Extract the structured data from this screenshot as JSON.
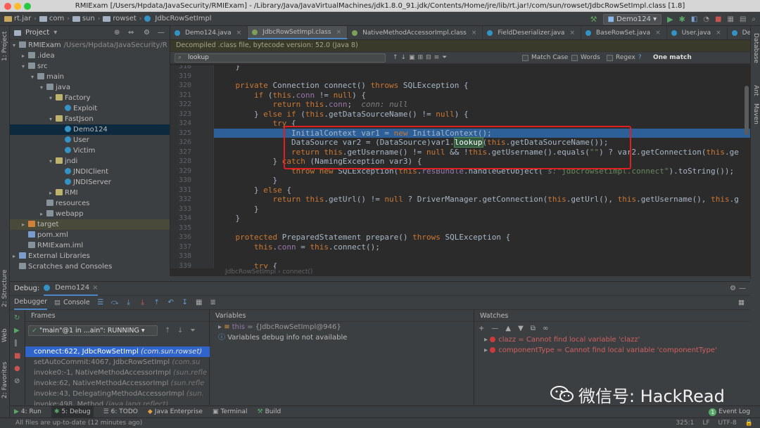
{
  "window": {
    "title": "RMIExam [/Users/Hpdata/JavaSecurity/RMIExam] - /Library/Java/JavaVirtualMachines/jdk1.8.0_91.jdk/Contents/Home/jre/lib/rt.jar!/com/sun/rowset/JdbcRowSetImpl.class [1.8]"
  },
  "navbar": {
    "crumbs": [
      "rt.jar",
      "com",
      "sun",
      "rowset",
      "JdbcRowSetImpl"
    ],
    "run_config": "Demo124"
  },
  "sidebar_left": {
    "labels": [
      "1: Project",
      "2: Structure",
      "Web",
      "2: Favorites"
    ]
  },
  "sidebar_right": {
    "labels": [
      "Database",
      "Ant",
      "Maven"
    ]
  },
  "project": {
    "header": "Project",
    "nodes": [
      {
        "label": "RMIExam",
        "path": "/Users/Hpdata/JavaSecurity/R",
        "indent": 0,
        "arrow": "▾",
        "icon": "folder"
      },
      {
        "label": ".idea",
        "indent": 1,
        "arrow": "▸",
        "icon": "folder"
      },
      {
        "label": "src",
        "indent": 1,
        "arrow": "▾",
        "icon": "folder"
      },
      {
        "label": "main",
        "indent": 2,
        "arrow": "▾",
        "icon": "folder"
      },
      {
        "label": "java",
        "indent": 3,
        "arrow": "▾",
        "icon": "folder"
      },
      {
        "label": "Factory",
        "indent": 4,
        "arrow": "▾",
        "icon": "package"
      },
      {
        "label": "Exploit",
        "indent": 5,
        "arrow": "",
        "icon": "class"
      },
      {
        "label": "FastJson",
        "indent": 4,
        "arrow": "▾",
        "icon": "package"
      },
      {
        "label": "Demo124",
        "indent": 5,
        "arrow": "",
        "icon": "class",
        "selected": true
      },
      {
        "label": "User",
        "indent": 5,
        "arrow": "",
        "icon": "class"
      },
      {
        "label": "Victim",
        "indent": 5,
        "arrow": "",
        "icon": "class"
      },
      {
        "label": "jndi",
        "indent": 4,
        "arrow": "▾",
        "icon": "package"
      },
      {
        "label": "JNDIClient",
        "indent": 5,
        "arrow": "",
        "icon": "class"
      },
      {
        "label": "JNDIServer",
        "indent": 5,
        "arrow": "",
        "icon": "class"
      },
      {
        "label": "RMI",
        "indent": 4,
        "arrow": "▸",
        "icon": "package"
      },
      {
        "label": "resources",
        "indent": 3,
        "arrow": "",
        "icon": "folder"
      },
      {
        "label": "webapp",
        "indent": 3,
        "arrow": "▸",
        "icon": "folder"
      },
      {
        "label": "target",
        "indent": 1,
        "arrow": "▸",
        "icon": "folder-orange",
        "selected_dim": true
      },
      {
        "label": "pom.xml",
        "indent": 1,
        "arrow": "",
        "icon": "maven"
      },
      {
        "label": "RMIExam.iml",
        "indent": 1,
        "arrow": "",
        "icon": "file"
      },
      {
        "label": "External Libraries",
        "indent": 0,
        "arrow": "▸",
        "icon": "library"
      },
      {
        "label": "Scratches and Consoles",
        "indent": 0,
        "arrow": "",
        "icon": "file"
      }
    ]
  },
  "editor": {
    "tabs": [
      {
        "label": "Demo124.java"
      },
      {
        "label": "JdbcRowSetImpl.class",
        "active": true
      },
      {
        "label": "NativeMethodAccessorImpl.class"
      },
      {
        "label": "FieldDeserializer.java"
      },
      {
        "label": "BaseRowSet.java"
      },
      {
        "label": "User.java"
      },
      {
        "label": "DefaultJSONParser"
      }
    ],
    "decompiled_notice": "Decompiled .class file, bytecode version: 52.0 (Java 8)",
    "find": {
      "query": "lookup",
      "match_case": "Match Case",
      "words": "Words",
      "regex": "Regex",
      "help": "?",
      "result": "One match"
    },
    "breadcrumb": "JdbcRowSetImpl  ›  connect()",
    "highlighted_line": 325,
    "lines": [
      {
        "n": "318",
        "html": "    }"
      },
      {
        "n": "319",
        "html": ""
      },
      {
        "n": "320",
        "html": "    <span class=\"kw\">private</span> Connection connect() <span class=\"kw\">throws</span> SQLException {"
      },
      {
        "n": "321",
        "html": "        <span class=\"kw\">if</span> (<span class=\"kw\">this</span>.<span class=\"fld\">conn</span> != <span class=\"kw\">null</span>) {"
      },
      {
        "n": "322",
        "html": "            <span class=\"kw\">return this</span>.<span class=\"fld\">conn</span>;  <span class=\"cmt\">conn: null</span>"
      },
      {
        "n": "323",
        "html": "        } <span class=\"kw\">else if</span> (<span class=\"kw\">this</span>.getDataSourceName() != <span class=\"kw\">null</span>) {"
      },
      {
        "n": "324",
        "html": "            <span class=\"kw\">try</span> {"
      },
      {
        "n": "325",
        "html": "                InitialContext var1 = <span class=\"kw\">new</span> InitialContext();"
      },
      {
        "n": "326",
        "html": "                DataSource var2 = (DataSource)var1.<span class=\"find\">lookup</span>(<span class=\"kw\">this</span>.getDataSourceName());"
      },
      {
        "n": "327",
        "html": "                <span class=\"kw\">return this</span>.getUsername() != <span class=\"kw\">null</span> &amp;&amp; !<span class=\"kw\">this</span>.getUsername().equals(<span class=\"str\">\"\"</span>) ? var2.getConnection(<span class=\"kw\">this</span>.ge"
      },
      {
        "n": "328",
        "html": "            } <span class=\"kw\">catch</span> (NamingException var3) {"
      },
      {
        "n": "329",
        "html": "                <span class=\"kw\">throw new</span> SQLException(<span class=\"kw\">this</span>.<span class=\"fld\">resBundle</span>.handleGetObject( <span class=\"cmt\">s:</span><span class=\"str\">\"jdbcrowsetimpl.connect\"</span>).toString());"
      },
      {
        "n": "330",
        "html": "            }"
      },
      {
        "n": "331",
        "html": "        } <span class=\"kw\">else</span> {"
      },
      {
        "n": "332",
        "html": "            <span class=\"kw\">return this</span>.getUrl() != <span class=\"kw\">null</span> ? DriverManager.getConnection(<span class=\"kw\">this</span>.getUrl(), <span class=\"kw\">this</span>.getUsername(), <span class=\"kw\">this</span>.g"
      },
      {
        "n": "333",
        "html": "        }"
      },
      {
        "n": "334",
        "html": "    }"
      },
      {
        "n": "335",
        "html": ""
      },
      {
        "n": "336",
        "html": "    <span class=\"kw\">protected</span> PreparedStatement prepare() <span class=\"kw\">throws</span> SQLException {"
      },
      {
        "n": "337",
        "html": "        <span class=\"kw\">this</span>.<span class=\"fld\">conn</span> = <span class=\"kw\">this</span>.connect();"
      },
      {
        "n": "338",
        "html": ""
      },
      {
        "n": "339",
        "html": "        <span class=\"kw\">try</span> {"
      }
    ]
  },
  "debug": {
    "title": "Debug:",
    "config": "Demo124",
    "tabs": [
      "Debugger",
      "Console"
    ],
    "frames_header": "Frames",
    "thread": "\"main\"@1 in ...ain\": RUNNING",
    "frames": [
      {
        "method": "connect:622, JdbcRowSetImpl",
        "pkg": "(com.sun.rowset)",
        "selected": true
      },
      {
        "method": "setAutoCommit:4067, JdbcRowSetImpl",
        "pkg": "(com.su"
      },
      {
        "method": "invoke0:-1, NativeMethodAccessorImpl",
        "pkg": "(sun.refle"
      },
      {
        "method": "invoke:62, NativeMethodAccessorImpl",
        "pkg": "(sun.refle"
      },
      {
        "method": "invoke:43, DelegatingMethodAccessorImpl",
        "pkg": "(sun."
      },
      {
        "method": "invoke:498, Method",
        "pkg": "(java.lang.reflect)"
      }
    ],
    "variables_header": "Variables",
    "variables": [
      {
        "name": "this",
        "value": "= {JdbcRowSetImpl@946}"
      },
      {
        "name": "",
        "value": "Variables debug info not available"
      }
    ],
    "watches_header": "Watches",
    "watches": [
      {
        "text": "clazz = Cannot find local variable 'clazz'"
      },
      {
        "text": "componentType = Cannot find local variable 'componentType'"
      }
    ]
  },
  "bottom_tabs": [
    "4: Run",
    "5: Debug",
    "6: TODO",
    "Java Enterprise",
    "Terminal",
    "Build"
  ],
  "event_log": "Event Log",
  "status": {
    "message": "All files are up-to-date (12 minutes ago)",
    "position": "325:1",
    "line_sep": "LF",
    "encoding": "UTF-8"
  },
  "watermark": {
    "text": "微信号: HackRead"
  }
}
